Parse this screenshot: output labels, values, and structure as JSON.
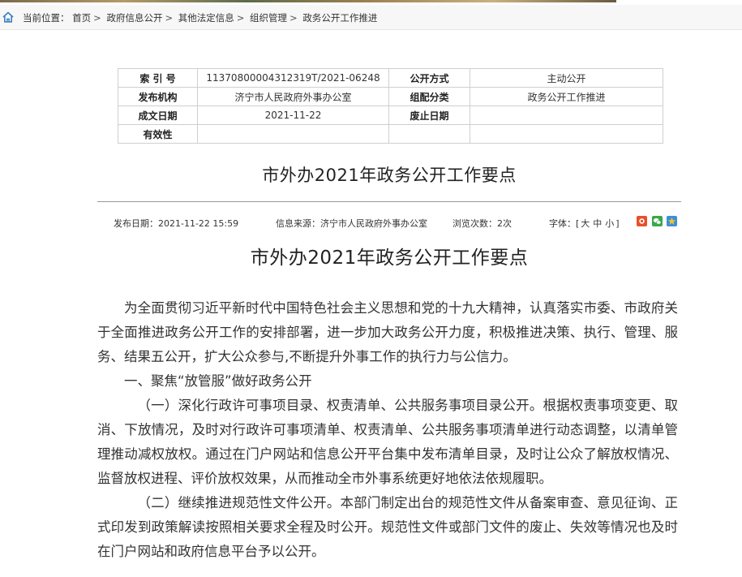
{
  "breadcrumb": {
    "prefix": "当前位置：",
    "items": [
      "首页",
      "政府信息公开",
      "其他法定信息",
      "组织管理",
      "政务公开工作推进"
    ],
    "separator": ">"
  },
  "meta": {
    "rows": [
      {
        "l1": "索 引 号",
        "v1": "11370800004312319T/2021-06248",
        "l2": "公开方式",
        "v2": "主动公开"
      },
      {
        "l1": "发布机构",
        "v1": "济宁市人民政府外事办公室",
        "l2": "组配分类",
        "v2": "政务公开工作推进"
      },
      {
        "l1": "成文日期",
        "v1": "2021-11-22",
        "l2": "废止日期",
        "v2": ""
      },
      {
        "l1": "有效性",
        "v1": "",
        "l2": "",
        "v2": ""
      }
    ]
  },
  "article": {
    "header_title": "市外办2021年政务公开工作要点",
    "publish_date": "发布日期：2021-11-22 15:59",
    "source": "信息来源：济宁市人民政府外事办公室",
    "views": "浏览次数：2次",
    "font_label": "字体：[",
    "font_large": "大",
    "font_medium": "中",
    "font_small": "小",
    "font_close": "]",
    "title": "市外办2021年政务公开工作要点",
    "paragraphs": [
      "为全面贯彻习近平新时代中国特色社会主义思想和党的十九大精神，认真落实市委、市政府关于全面推进政务公开工作的安排部署，进一步加大政务公开力度，积极推进决策、执行、管理、服务、结果五公开，扩大公众参与,不断提升外事工作的执行力与公信力。",
      "一、聚焦“放管服”做好政务公开",
      "（一）深化行政许可事项目录、权责清单、公共服务事项目录公开。根据权责事项变更、取消、下放情况，及时对行政许可事项清单、权责清单、公共服务事项清单进行动态调整，以清单管理推动减权放权。通过在门户网站和信息公开平台集中发布清单目录，及时让公众了解放权情况、监督放权进程、评价放权效果，从而推动全市外事系统更好地依法依规履职。",
      "（二）继续推进规范性文件公开。本部门制定出台的规范性文件从备案审查、意见征询、正式印发到政策解读按照相关要求全程及时公开。规范性文件或部门文件的废止、失效等情况也及时在门户网站和政府信息平台予以公开。"
    ]
  },
  "colors": {
    "share1": "#e8502a",
    "share2": "#3aa84a",
    "share3": "#3c8fd8"
  },
  "icons": [
    "home-icon",
    "share-icon",
    "wechat-icon",
    "qzone-icon"
  ]
}
